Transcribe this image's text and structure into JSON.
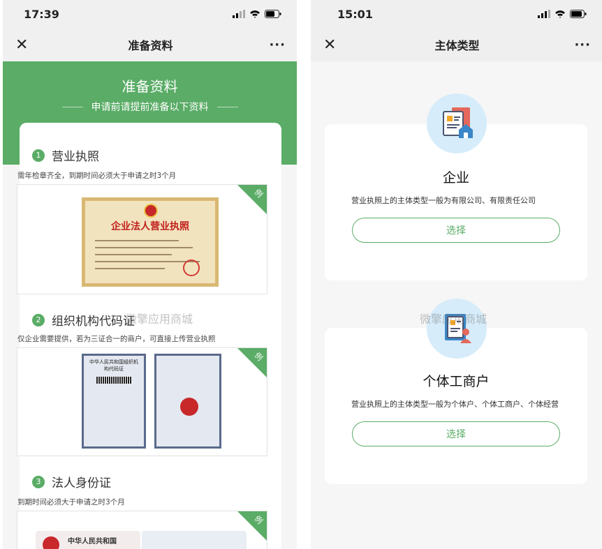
{
  "left": {
    "status": {
      "time": "17:39"
    },
    "nav": {
      "close": "✕",
      "title": "准备资料",
      "more": "···"
    },
    "header": {
      "title": "准备资料",
      "subtitle": "申请前请提前准备以下资料"
    },
    "sections": [
      {
        "num": "1",
        "title": "营业执照",
        "desc": "需年检章齐全，到期时间必须大于申请之时3个月",
        "badge": "例",
        "image_text": "企业法人营业执照"
      },
      {
        "num": "2",
        "title": "组织机构代码证",
        "desc": "仅企业需要提供，若为三证合一的商户，可直接上传营业执照",
        "badge": "例",
        "image_text": "中华人民共和国组织机构代码证"
      },
      {
        "num": "3",
        "title": "法人身份证",
        "desc": "到期时间必须大于申请之时3个月",
        "badge": "例",
        "image_text": "中华人民共和国"
      }
    ],
    "watermark": "微擎应用商城"
  },
  "right": {
    "status": {
      "time": "15:01"
    },
    "nav": {
      "close": "✕",
      "title": "主体类型",
      "more": "···"
    },
    "options": [
      {
        "title": "企业",
        "desc": "营业执照上的主体类型一般为有限公司、有限责任公司",
        "button": "选择",
        "icon": "enterprise-building-icon"
      },
      {
        "title": "个体工商户",
        "desc": "营业执照上的主体类型一般为个体户、个体工商户、个体经营",
        "button": "选择",
        "icon": "individual-business-icon"
      }
    ],
    "watermark": "微擎应用商城"
  },
  "colors": {
    "accent": "#5aac66",
    "icon_bg": "#d6ecfa"
  }
}
